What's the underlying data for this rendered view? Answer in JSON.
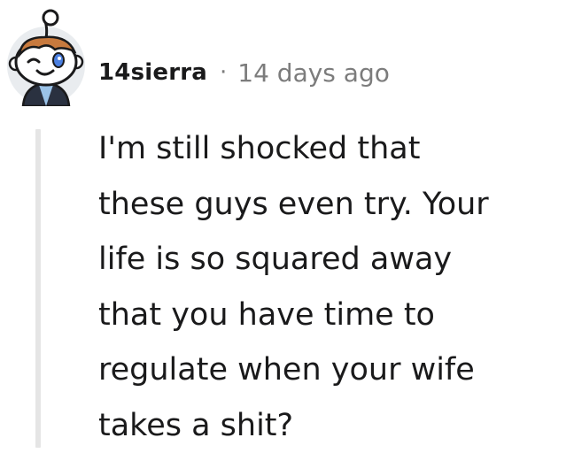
{
  "comment": {
    "username": "14sierra",
    "separator": "·",
    "timestamp": "14 days ago",
    "avatar_icon": "snoo-avatar-icon",
    "body_lines": [
      "I'm still shocked that",
      "these guys even try. Your",
      "life is so squared away",
      "that you have time to",
      "regulate when your wife",
      "takes a shit?"
    ]
  },
  "colors": {
    "text": "#1a1a1b",
    "meta": "#7c7c7c",
    "thread_line": "#e5e5e5",
    "avatar_hair": "#c87a3e",
    "avatar_jacket": "#2a3140",
    "avatar_shirt": "#9bc3e8"
  }
}
